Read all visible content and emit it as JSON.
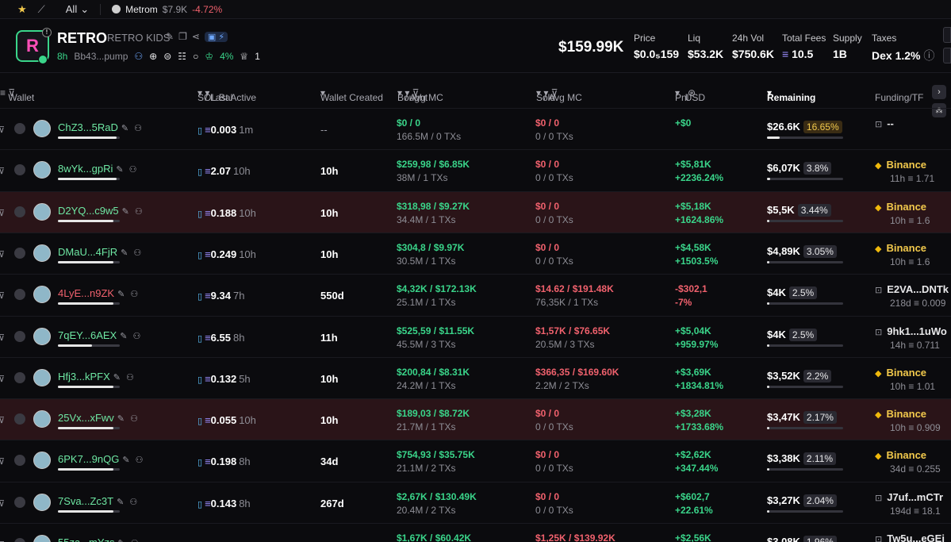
{
  "topbar": {
    "all_label": "All",
    "ticker": {
      "name": "Metrom",
      "mc": "$7.9K",
      "change": "-4.72%"
    }
  },
  "token": {
    "symbol": "RETRO",
    "name": "RETRO KIDS",
    "age": "8h",
    "address": "Bb43...pump",
    "holders_pct": "4%",
    "count": "1",
    "market_cap": "$159.99K",
    "stats": [
      {
        "label": "Price",
        "value": "$0.0₅159"
      },
      {
        "label": "Liq",
        "value": "$53.2K"
      },
      {
        "label": "24h Vol",
        "value": "$750.6K"
      },
      {
        "label": "Total Fees",
        "value": "10.5"
      },
      {
        "label": "Supply",
        "value": "1B"
      },
      {
        "label": "Taxes",
        "value": "Dex 1.2%"
      }
    ]
  },
  "table": {
    "headers": {
      "wallet": "Wallet",
      "sol_bal": "SOL Bal",
      "last_active": "/ Last Active",
      "wallet_created": "Wallet Created",
      "bought": "Bought",
      "avg_mc_bought": "/ Avg MC",
      "sold": "Sold",
      "avg_mc_sold": "/ Avg MC",
      "pnl": "Pnl",
      "usd": "USD",
      "remaining": "Remaining",
      "funding": "Funding/TF"
    },
    "rows": [
      {
        "wallet": "ChZ3...5RaD",
        "addr_color": "green",
        "bar": 0.95,
        "sol": "0.003",
        "ago": "1m",
        "created": "--",
        "bought": "$0 / 0",
        "bought_sub": "166.5M / 0 TXs",
        "sold": "$0 / 0",
        "sold_sub": "0 / 0 TXs",
        "pnl": "+$0",
        "pnl_pct": "",
        "pnl_color": "g",
        "rem": "$26.6K",
        "rem_pct": "16.65%",
        "rem_fill": 0.17,
        "fund": "--",
        "fund_sub": "",
        "fund_type": "box",
        "hl": false
      },
      {
        "wallet": "8wYk...gpRi",
        "addr_color": "green",
        "bar": 0.95,
        "sol": "2.07",
        "ago": "10h",
        "created": "10h",
        "bought": "$259,98 / $6.85K",
        "bought_sub": "38M / 1 TXs",
        "sold": "$0 / 0",
        "sold_sub": "0 / 0 TXs",
        "pnl": "+$5,81K",
        "pnl_pct": "+2236.24%",
        "pnl_color": "g",
        "rem": "$6,07K",
        "rem_pct": "3.8%",
        "rem_fill": 0.04,
        "fund": "Binance",
        "fund_sub": "11h ≡ 1.71",
        "fund_type": "bn",
        "hl": false
      },
      {
        "wallet": "D2YQ...c9w5",
        "addr_color": "green",
        "bar": 0.9,
        "sol": "0.188",
        "ago": "10h",
        "created": "10h",
        "bought": "$318,98 / $9.27K",
        "bought_sub": "34.4M / 1 TXs",
        "sold": "$0 / 0",
        "sold_sub": "0 / 0 TXs",
        "pnl": "+$5,18K",
        "pnl_pct": "+1624.86%",
        "pnl_color": "g",
        "rem": "$5,5K",
        "rem_pct": "3.44%",
        "rem_fill": 0.035,
        "fund": "Binance",
        "fund_sub": "10h ≡ 1.6",
        "fund_type": "bn",
        "hl": true
      },
      {
        "wallet": "DMaU...4FjR",
        "addr_color": "green",
        "bar": 0.9,
        "sol": "0.249",
        "ago": "10h",
        "created": "10h",
        "bought": "$304,8 / $9.97K",
        "bought_sub": "30.5M / 1 TXs",
        "sold": "$0 / 0",
        "sold_sub": "0 / 0 TXs",
        "pnl": "+$4,58K",
        "pnl_pct": "+1503.5%",
        "pnl_color": "g",
        "rem": "$4,89K",
        "rem_pct": "3.05%",
        "rem_fill": 0.03,
        "fund": "Binance",
        "fund_sub": "10h ≡ 1.6",
        "fund_type": "bn",
        "hl": false
      },
      {
        "wallet": "4LyE...n9ZK",
        "addr_color": "red",
        "bar": 0.9,
        "sol": "9.34",
        "ago": "7h",
        "created": "550d",
        "bought": "$4,32K / $172.13K",
        "bought_sub": "25.1M / 1 TXs",
        "sold": "$14.62 / $191.48K",
        "sold_sub": "76,35K / 1 TXs",
        "pnl": "-$302,1",
        "pnl_pct": "-7%",
        "pnl_color": "r",
        "rem": "$4K",
        "rem_pct": "2.5%",
        "rem_fill": 0.025,
        "fund": "E2VA...DNTk",
        "fund_sub": "218d ≡ 0.009",
        "fund_type": "box",
        "hl": false
      },
      {
        "wallet": "7qEY...6AEX",
        "addr_color": "green",
        "bar": 0.55,
        "sol": "6.55",
        "ago": "8h",
        "created": "11h",
        "bought": "$525,59 / $11.55K",
        "bought_sub": "45.5M / 3 TXs",
        "sold": "$1,57K / $76.65K",
        "sold_sub": "20.5M / 3 TXs",
        "pnl": "+$5,04K",
        "pnl_pct": "+959.97%",
        "pnl_color": "g",
        "rem": "$4K",
        "rem_pct": "2.5%",
        "rem_fill": 0.025,
        "fund": "9hk1...1uWo",
        "fund_sub": "14h ≡ 0.711",
        "fund_type": "box",
        "hl": false
      },
      {
        "wallet": "Hfj3...kPFX",
        "addr_color": "green",
        "bar": 0.9,
        "sol": "0.132",
        "ago": "5h",
        "created": "10h",
        "bought": "$200,84 / $8.31K",
        "bought_sub": "24.2M / 1 TXs",
        "sold": "$366,35 / $169.60K",
        "sold_sub": "2.2M / 2 TXs",
        "pnl": "+$3,69K",
        "pnl_pct": "+1834.81%",
        "pnl_color": "g",
        "rem": "$3,52K",
        "rem_pct": "2.2%",
        "rem_fill": 0.022,
        "fund": "Binance",
        "fund_sub": "10h ≡ 1.01",
        "fund_type": "bn",
        "hl": false
      },
      {
        "wallet": "25Vx...xFwv",
        "addr_color": "green",
        "bar": 0.9,
        "sol": "0.055",
        "ago": "10h",
        "created": "10h",
        "bought": "$189,03 / $8.72K",
        "bought_sub": "21.7M / 1 TXs",
        "sold": "$0 / 0",
        "sold_sub": "0 / 0 TXs",
        "pnl": "+$3,28K",
        "pnl_pct": "+1733.68%",
        "pnl_color": "g",
        "rem": "$3,47K",
        "rem_pct": "2.17%",
        "rem_fill": 0.022,
        "fund": "Binance",
        "fund_sub": "10h ≡ 0.909",
        "fund_type": "bn",
        "hl": true
      },
      {
        "wallet": "6PK7...9nQG",
        "addr_color": "green",
        "bar": 0.9,
        "sol": "0.198",
        "ago": "8h",
        "created": "34d",
        "bought": "$754,93 / $35.75K",
        "bought_sub": "21.1M / 2 TXs",
        "sold": "$0 / 0",
        "sold_sub": "0 / 0 TXs",
        "pnl": "+$2,62K",
        "pnl_pct": "+347.44%",
        "pnl_color": "g",
        "rem": "$3,38K",
        "rem_pct": "2.11%",
        "rem_fill": 0.021,
        "fund": "Binance",
        "fund_sub": "34d ≡ 0.255",
        "fund_type": "bn",
        "hl": false
      },
      {
        "wallet": "7Sva...Zc3T",
        "addr_color": "green",
        "bar": 0.9,
        "sol": "0.143",
        "ago": "8h",
        "created": "267d",
        "bought": "$2,67K / $130.49K",
        "bought_sub": "20.4M / 2 TXs",
        "sold": "$0 / 0",
        "sold_sub": "0 / 0 TXs",
        "pnl": "+$602,7",
        "pnl_pct": "+22.61%",
        "pnl_color": "g",
        "rem": "$3,27K",
        "rem_pct": "2.04%",
        "rem_fill": 0.02,
        "fund": "J7uf...mCTr",
        "fund_sub": "194d ≡ 18.1",
        "fund_type": "box",
        "hl": false
      },
      {
        "wallet": "55za...mYzs",
        "addr_color": "green",
        "bar": 0.9,
        "sol": "",
        "ago": "",
        "created": "",
        "bought": "$1,67K / $60.42K",
        "bought_sub": "",
        "sold": "$1,25K / $139.92K",
        "sold_sub": "",
        "pnl": "+$2,56K",
        "pnl_pct": "",
        "pnl_color": "g",
        "rem": "$3,08K",
        "rem_pct": "1.96%",
        "rem_fill": 0.02,
        "fund": "Tw5u...eGEi",
        "fund_sub": "",
        "fund_type": "box",
        "hl": false
      }
    ]
  }
}
